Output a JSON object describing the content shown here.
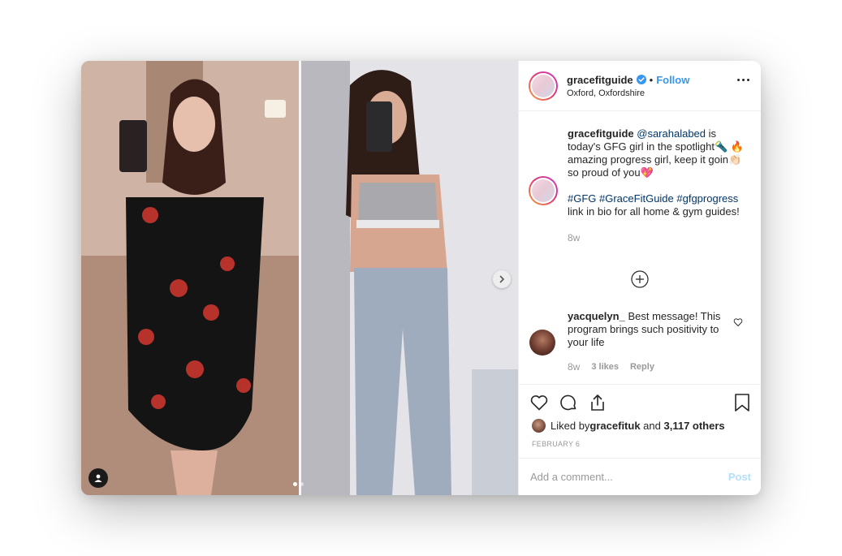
{
  "colors": {
    "accent": "#3897f0",
    "link": "#003569",
    "muted": "#999999",
    "post_disabled": "#b2dffc"
  },
  "media": {
    "slide_count": 2,
    "active_slide": 1
  },
  "header": {
    "username": "gracefitguide",
    "bullet": "•",
    "follow_label": "Follow",
    "location": "Oxford, Oxfordshire"
  },
  "caption": {
    "username": "gracefitguide",
    "mention": "@sarahalabed",
    "line1_rest": " is today's GFG girl in the spotlight🔦",
    "line2": "🔥 amazing progress girl, keep it goin👏🏻 so proud of you💖",
    "hashtags": "#GFG #GraceFitGuide #gfgprogress",
    "line4": "link in bio for all home & gym guides!",
    "time": "8w"
  },
  "comment": {
    "username": "yacquelyn_",
    "text": " Best message! This program brings such positivity to your life",
    "time": "8w",
    "likes": "3 likes",
    "reply": "Reply"
  },
  "footer": {
    "liked_prefix": "Liked by ",
    "liked_user": "gracefituk",
    "liked_and": " and ",
    "liked_count": "3,117 others",
    "date": "FEBRUARY 6",
    "comment_placeholder": "Add a comment...",
    "post_label": "Post"
  }
}
